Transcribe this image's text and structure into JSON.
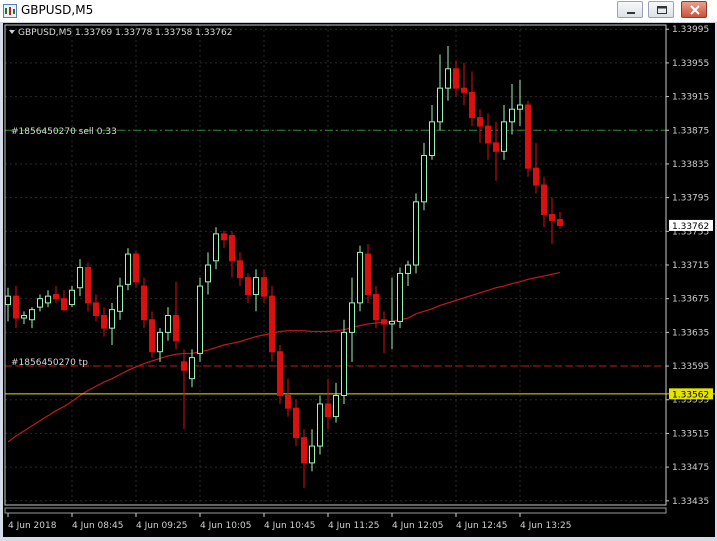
{
  "window": {
    "title": "GBPUSD,M5"
  },
  "chart_header": {
    "text": "GBPUSD,M5  1.33769 1.33778 1.33758 1.33762"
  },
  "order_lines": {
    "sell_label": "#1856450270 sell 0.33",
    "tp_label": "#1856450270 tp"
  },
  "colors": {
    "background": "#000000",
    "grid": "#2a2a2a",
    "bull": "#98f5b4",
    "bear": "#d8100f",
    "axis_text": "#cfcfcf",
    "sell_line": "#2e8b2e",
    "tp_line": "#c41a1a",
    "yellow_line": "#e4e400",
    "ma_line": "#c11a1a"
  },
  "price_axis": {
    "ticks": [
      "1.33995",
      "1.33955",
      "1.33915",
      "1.33875",
      "1.33835",
      "1.33795",
      "1.33755",
      "1.33715",
      "1.33675",
      "1.33635",
      "1.33595",
      "1.33555",
      "1.33515",
      "1.33475",
      "1.33435"
    ]
  },
  "price_tags": {
    "current": "1.33762",
    "yellow": "1.33562"
  },
  "time_axis": {
    "labels": [
      "4 Jun 2018",
      "4 Jun 08:45",
      "4 Jun 09:25",
      "4 Jun 10:05",
      "4 Jun 10:45",
      "4 Jun 11:25",
      "4 Jun 12:05",
      "4 Jun 12:45",
      "4 Jun 13:25"
    ]
  },
  "chart_data": {
    "type": "candlestick",
    "symbol": "GBPUSD",
    "timeframe": "M5",
    "ylim": [
      1.3343,
      1.34
    ],
    "sell_price": 1.33875,
    "tp_price": 1.33595,
    "yellow_price": 1.33562,
    "candles": [
      {
        "o": 1.33668,
        "h": 1.33688,
        "l": 1.33648,
        "c": 1.33678
      },
      {
        "o": 1.33678,
        "h": 1.3369,
        "l": 1.3364,
        "c": 1.33652
      },
      {
        "o": 1.33652,
        "h": 1.3366,
        "l": 1.33645,
        "c": 1.33655
      },
      {
        "o": 1.3365,
        "h": 1.33665,
        "l": 1.3364,
        "c": 1.33662
      },
      {
        "o": 1.33665,
        "h": 1.3368,
        "l": 1.3366,
        "c": 1.33675
      },
      {
        "o": 1.3367,
        "h": 1.33685,
        "l": 1.33665,
        "c": 1.33678
      },
      {
        "o": 1.3368,
        "h": 1.3369,
        "l": 1.3367,
        "c": 1.33675
      },
      {
        "o": 1.33675,
        "h": 1.33685,
        "l": 1.3366,
        "c": 1.33662
      },
      {
        "o": 1.33668,
        "h": 1.3369,
        "l": 1.33665,
        "c": 1.33685
      },
      {
        "o": 1.33688,
        "h": 1.33722,
        "l": 1.33678,
        "c": 1.33712
      },
      {
        "o": 1.33712,
        "h": 1.33718,
        "l": 1.3366,
        "c": 1.3367
      },
      {
        "o": 1.3367,
        "h": 1.3368,
        "l": 1.33648,
        "c": 1.33655
      },
      {
        "o": 1.33655,
        "h": 1.33665,
        "l": 1.3363,
        "c": 1.3364
      },
      {
        "o": 1.3364,
        "h": 1.3367,
        "l": 1.3362,
        "c": 1.33662
      },
      {
        "o": 1.3366,
        "h": 1.337,
        "l": 1.3365,
        "c": 1.3369
      },
      {
        "o": 1.33692,
        "h": 1.33735,
        "l": 1.33685,
        "c": 1.33728
      },
      {
        "o": 1.33728,
        "h": 1.33732,
        "l": 1.33688,
        "c": 1.33695
      },
      {
        "o": 1.3369,
        "h": 1.337,
        "l": 1.3364,
        "c": 1.3365
      },
      {
        "o": 1.3365,
        "h": 1.3366,
        "l": 1.33605,
        "c": 1.33612
      },
      {
        "o": 1.33612,
        "h": 1.3364,
        "l": 1.336,
        "c": 1.33635
      },
      {
        "o": 1.33635,
        "h": 1.33665,
        "l": 1.33625,
        "c": 1.33655
      },
      {
        "o": 1.33655,
        "h": 1.33695,
        "l": 1.33615,
        "c": 1.33625
      },
      {
        "o": 1.336,
        "h": 1.33615,
        "l": 1.3352,
        "c": 1.3359
      },
      {
        "o": 1.3358,
        "h": 1.33615,
        "l": 1.3357,
        "c": 1.33605
      },
      {
        "o": 1.3361,
        "h": 1.337,
        "l": 1.336,
        "c": 1.3369
      },
      {
        "o": 1.33695,
        "h": 1.3373,
        "l": 1.3368,
        "c": 1.33715
      },
      {
        "o": 1.3372,
        "h": 1.3376,
        "l": 1.3371,
        "c": 1.33752
      },
      {
        "o": 1.33752,
        "h": 1.33756,
        "l": 1.33735,
        "c": 1.33745
      },
      {
        "o": 1.3375,
        "h": 1.33755,
        "l": 1.337,
        "c": 1.3372
      },
      {
        "o": 1.3372,
        "h": 1.3373,
        "l": 1.3369,
        "c": 1.337
      },
      {
        "o": 1.337,
        "h": 1.33705,
        "l": 1.3367,
        "c": 1.3368
      },
      {
        "o": 1.3368,
        "h": 1.3371,
        "l": 1.3366,
        "c": 1.337
      },
      {
        "o": 1.337,
        "h": 1.3371,
        "l": 1.3367,
        "c": 1.33678
      },
      {
        "o": 1.33678,
        "h": 1.3369,
        "l": 1.336,
        "c": 1.33612
      },
      {
        "o": 1.33612,
        "h": 1.3362,
        "l": 1.3355,
        "c": 1.3356
      },
      {
        "o": 1.3356,
        "h": 1.3358,
        "l": 1.33535,
        "c": 1.33545
      },
      {
        "o": 1.33545,
        "h": 1.33555,
        "l": 1.335,
        "c": 1.3351
      },
      {
        "o": 1.3351,
        "h": 1.3352,
        "l": 1.3345,
        "c": 1.3348
      },
      {
        "o": 1.3348,
        "h": 1.3352,
        "l": 1.3347,
        "c": 1.335
      },
      {
        "o": 1.335,
        "h": 1.3356,
        "l": 1.3349,
        "c": 1.3355
      },
      {
        "o": 1.3355,
        "h": 1.3358,
        "l": 1.3352,
        "c": 1.33535
      },
      {
        "o": 1.33535,
        "h": 1.33575,
        "l": 1.33528,
        "c": 1.3356
      },
      {
        "o": 1.3356,
        "h": 1.3365,
        "l": 1.3355,
        "c": 1.33635
      },
      {
        "o": 1.33635,
        "h": 1.337,
        "l": 1.336,
        "c": 1.3367
      },
      {
        "o": 1.3367,
        "h": 1.33738,
        "l": 1.3366,
        "c": 1.3373
      },
      {
        "o": 1.33728,
        "h": 1.3374,
        "l": 1.3367,
        "c": 1.3368
      },
      {
        "o": 1.3368,
        "h": 1.3369,
        "l": 1.3364,
        "c": 1.3365
      },
      {
        "o": 1.3365,
        "h": 1.3366,
        "l": 1.3361,
        "c": 1.33645
      },
      {
        "o": 1.33645,
        "h": 1.337,
        "l": 1.33615,
        "c": 1.33648
      },
      {
        "o": 1.33648,
        "h": 1.33712,
        "l": 1.3364,
        "c": 1.33705
      },
      {
        "o": 1.33705,
        "h": 1.3372,
        "l": 1.3369,
        "c": 1.33715
      },
      {
        "o": 1.33715,
        "h": 1.338,
        "l": 1.33705,
        "c": 1.3379
      },
      {
        "o": 1.3379,
        "h": 1.3386,
        "l": 1.3378,
        "c": 1.33845
      },
      {
        "o": 1.33845,
        "h": 1.33905,
        "l": 1.3384,
        "c": 1.33885
      },
      {
        "o": 1.33885,
        "h": 1.33965,
        "l": 1.33875,
        "c": 1.33925
      },
      {
        "o": 1.33925,
        "h": 1.33975,
        "l": 1.3391,
        "c": 1.33948
      },
      {
        "o": 1.33948,
        "h": 1.33958,
        "l": 1.33915,
        "c": 1.33925
      },
      {
        "o": 1.33925,
        "h": 1.33955,
        "l": 1.33905,
        "c": 1.3392
      },
      {
        "o": 1.3392,
        "h": 1.33945,
        "l": 1.3388,
        "c": 1.3389
      },
      {
        "o": 1.3389,
        "h": 1.339,
        "l": 1.3386,
        "c": 1.3388
      },
      {
        "o": 1.3388,
        "h": 1.33895,
        "l": 1.3384,
        "c": 1.3386
      },
      {
        "o": 1.3386,
        "h": 1.33885,
        "l": 1.33815,
        "c": 1.3385
      },
      {
        "o": 1.3385,
        "h": 1.33905,
        "l": 1.3384,
        "c": 1.33885
      },
      {
        "o": 1.33885,
        "h": 1.3393,
        "l": 1.3387,
        "c": 1.339
      },
      {
        "o": 1.339,
        "h": 1.33935,
        "l": 1.3388,
        "c": 1.33905
      },
      {
        "o": 1.33905,
        "h": 1.3391,
        "l": 1.3382,
        "c": 1.3383
      },
      {
        "o": 1.3383,
        "h": 1.3386,
        "l": 1.338,
        "c": 1.3381
      },
      {
        "o": 1.3381,
        "h": 1.3382,
        "l": 1.3376,
        "c": 1.33775
      },
      {
        "o": 1.33775,
        "h": 1.33795,
        "l": 1.3374,
        "c": 1.33768
      },
      {
        "o": 1.33769,
        "h": 1.33778,
        "l": 1.33758,
        "c": 1.33762
      }
    ],
    "ma": [
      1.33505,
      1.33512,
      1.33518,
      1.33524,
      1.3353,
      1.33536,
      1.33542,
      1.33547,
      1.33553,
      1.3356,
      1.33566,
      1.33571,
      1.33576,
      1.3358,
      1.33585,
      1.3359,
      1.33594,
      1.33598,
      1.33601,
      1.33604,
      1.33607,
      1.33609,
      1.3361,
      1.3361,
      1.33612,
      1.33614,
      1.33617,
      1.3362,
      1.33622,
      1.33624,
      1.33627,
      1.3363,
      1.33632,
      1.33634,
      1.33636,
      1.33637,
      1.33637,
      1.33637,
      1.33636,
      1.33636,
      1.33636,
      1.33637,
      1.33638,
      1.33641,
      1.33643,
      1.33645,
      1.33646,
      1.33647,
      1.33648,
      1.3365,
      1.33652,
      1.33657,
      1.3366,
      1.33663,
      1.33667,
      1.3367,
      1.33673,
      1.33676,
      1.33679,
      1.33682,
      1.33685,
      1.33688,
      1.3369,
      1.33693,
      1.33695,
      1.33698,
      1.337,
      1.33702,
      1.33704,
      1.33706
    ]
  }
}
